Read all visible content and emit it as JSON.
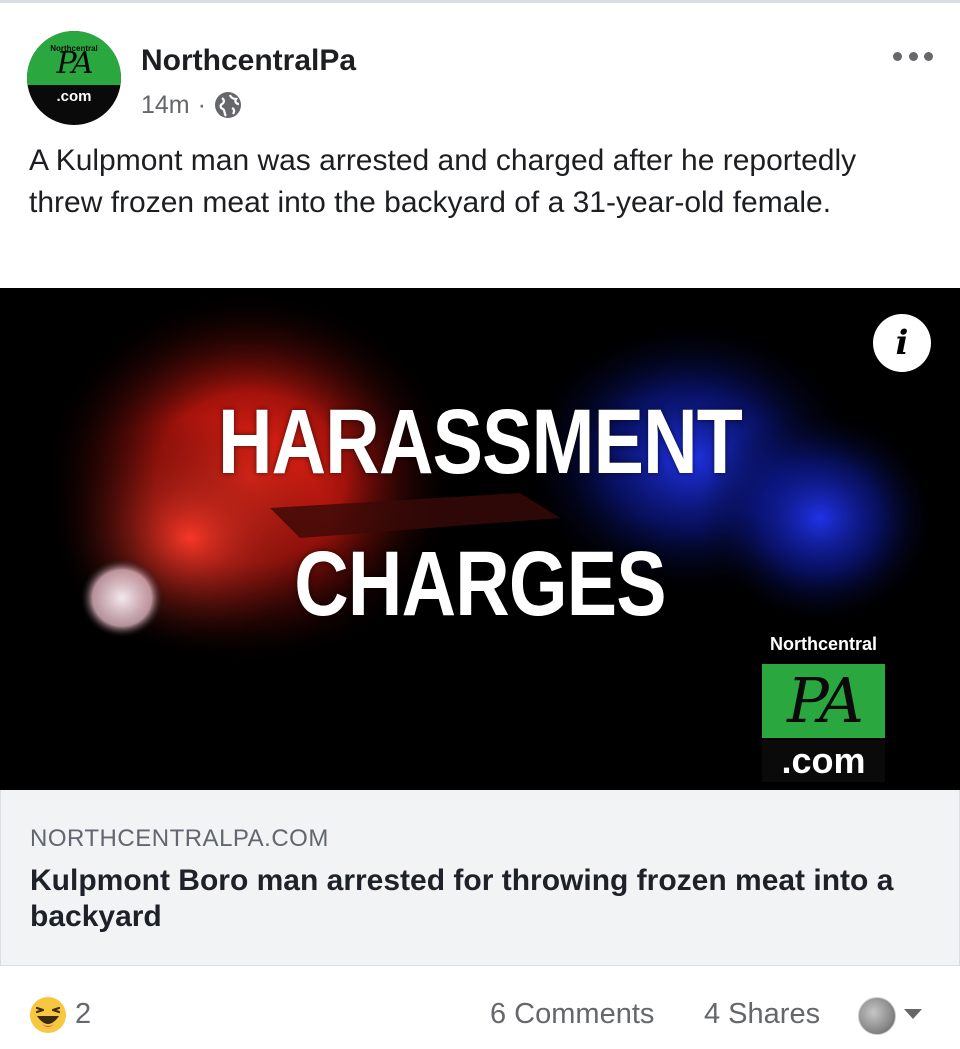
{
  "post": {
    "page_name": "NorthcentralPa",
    "timestamp": "14m",
    "separator": "·",
    "audience_icon": "globe-icon",
    "text": "A Kulpmont man was arrested and charged after he reportedly threw frozen meat into the backyard of a 31-year-old female."
  },
  "avatar": {
    "brand_small": "Northcentral",
    "logo_mark": "PA",
    "dotcom": ".com"
  },
  "image": {
    "headline_line1": "HARASSMENT",
    "headline_line2": "CHARGES",
    "info_glyph": "i",
    "logo_brand": "Northcentral",
    "logo_mark": "PA",
    "logo_dotcom": ".com"
  },
  "link_preview": {
    "domain": "NORTHCENTRALPA.COM",
    "title": "Kulpmont Boro man arrested for throwing frozen meat into a backyard"
  },
  "footer": {
    "reaction_icon": "haha-emoji-icon",
    "reaction_count": "2",
    "comments": "6 Comments",
    "shares": "4 Shares"
  },
  "colors": {
    "brand_green": "#2aa83f",
    "text_primary": "#1c1e21",
    "text_secondary": "#65676b",
    "link_bg": "#f2f3f5"
  }
}
